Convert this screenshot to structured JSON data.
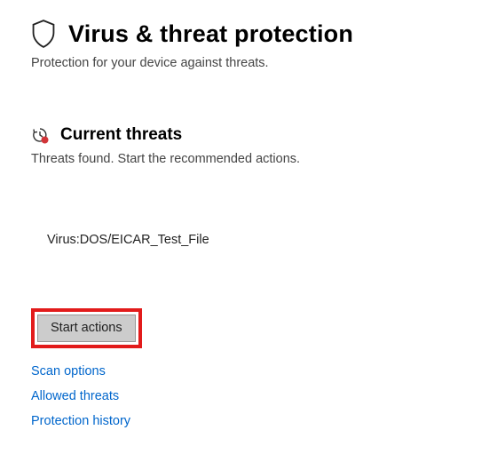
{
  "header": {
    "title": "Virus & threat protection",
    "subtitle": "Protection for your device against threats."
  },
  "section": {
    "title": "Current threats",
    "subtitle": "Threats found. Start the recommended actions."
  },
  "threats": [
    {
      "name": "Virus:DOS/EICAR_Test_File"
    }
  ],
  "actions": {
    "start_button_label": "Start actions"
  },
  "links": {
    "scan_options": "Scan options",
    "allowed_threats": "Allowed threats",
    "protection_history": "Protection history"
  }
}
